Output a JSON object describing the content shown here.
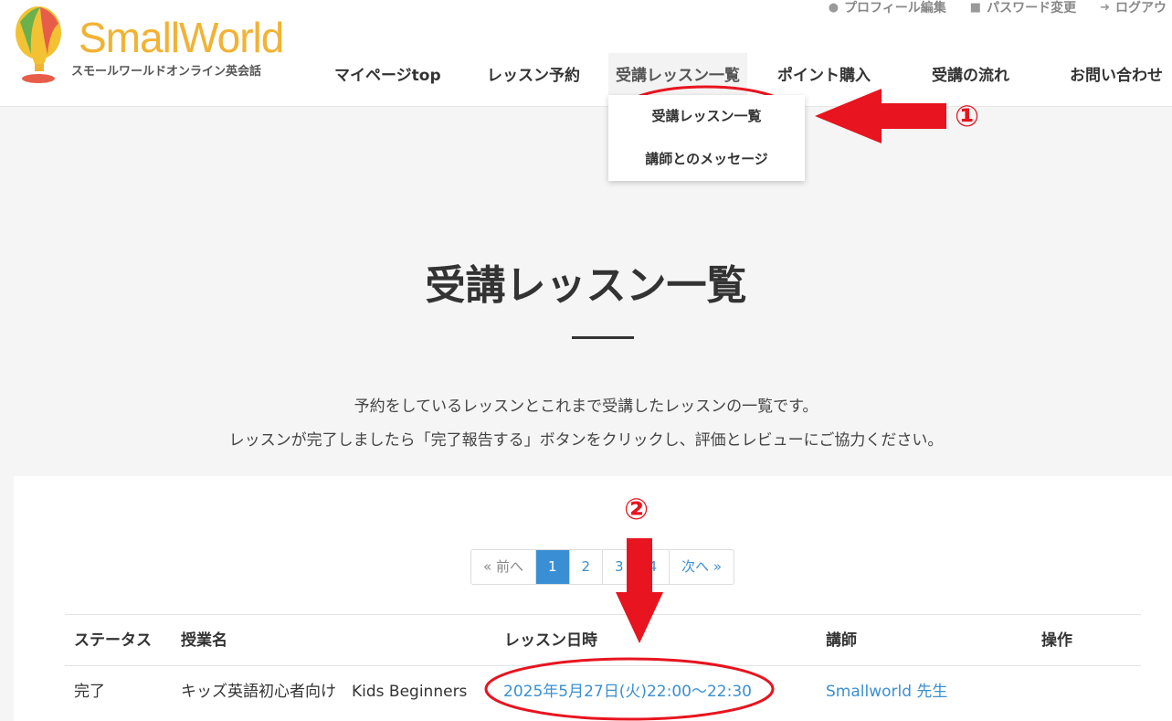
{
  "logo": {
    "name": "SmallWorld",
    "subtitle": "スモールワールドオンライン英会話"
  },
  "util_nav": [
    {
      "label": "プロフィール編集",
      "icon": "user-circle-icon"
    },
    {
      "label": "パスワード変更",
      "icon": "lock-icon"
    },
    {
      "label": "ログアウ",
      "icon": "sign-out-icon"
    }
  ],
  "nav": [
    {
      "label": "マイページtop"
    },
    {
      "label": "レッスン予約"
    },
    {
      "label": "受講レッスン一覧"
    },
    {
      "label": "ポイント購入"
    },
    {
      "label": "受講の流れ"
    },
    {
      "label": "お問い合わせ"
    }
  ],
  "dropdown": [
    {
      "label": "受講レッスン一覧"
    },
    {
      "label": "講師とのメッセージ"
    }
  ],
  "page": {
    "title": "受講レッスン一覧",
    "intro_line1": "予約をしているレッスンとこれまで受講したレッスンの一覧です。",
    "intro_line2": "レッスンが完了しましたら「完了報告する」ボタンをクリックし、評価とレビューにご協力ください。"
  },
  "pagination": {
    "prev": "« 前へ",
    "pages": [
      "1",
      "2",
      "3",
      "4"
    ],
    "current": "1",
    "next": "次へ »"
  },
  "table": {
    "headers": [
      "ステータス",
      "授業名",
      "レッスン日時",
      "講師",
      "操作"
    ],
    "rows": [
      {
        "status": "完了",
        "course": "キッズ英語初心者向け　Kids Beginners",
        "datetime": "2025年5月27日(火)22:00～22:30",
        "teacher": "Smallworld 先生",
        "action": ""
      }
    ]
  },
  "annotations": {
    "marker1": "①",
    "marker2": "②",
    "color": "#e8141f"
  },
  "colors": {
    "brand": "#f2b233",
    "link": "#3c8fd0",
    "current_page": "#3a8fd4"
  }
}
